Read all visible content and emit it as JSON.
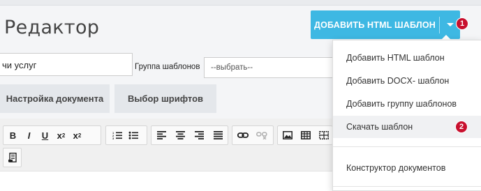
{
  "page": {
    "title": "Редактор"
  },
  "add_button": {
    "label": "ДОБАВИТЬ HTML ШАБЛОН"
  },
  "badges": {
    "first": "1",
    "second": "2"
  },
  "form": {
    "service_value": "чи услуг",
    "group_label": "Группа шаблонов",
    "group_select_value": "--выбрать--"
  },
  "tabs": [
    {
      "label": "Настройка документа"
    },
    {
      "label": "Выбор шрифтов"
    }
  ],
  "toolbar": {
    "bold": "B",
    "italic": "I",
    "underline": "U",
    "subscript": "x",
    "superscript": "x",
    "sub_mark": "2",
    "sup_mark": "2"
  },
  "dropdown": {
    "items": [
      {
        "label": "Добавить HTML шаблон"
      },
      {
        "label": "Добавить DOCX- шаблон"
      },
      {
        "label": "Добавить группу шаблонов"
      },
      {
        "label": "Скачать шаблон"
      },
      {
        "label": "Конструктор документов"
      }
    ]
  },
  "colors": {
    "accent": "#3eb8e3",
    "badge": "#c8102e",
    "tab_bg": "#e4e7eb"
  }
}
